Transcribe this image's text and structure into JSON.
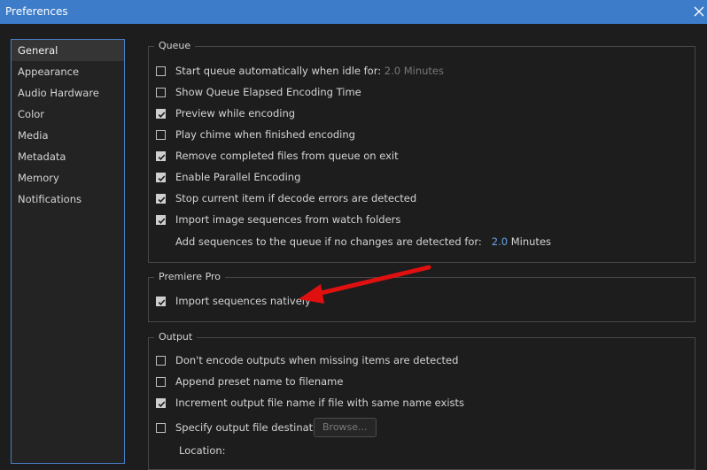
{
  "window": {
    "title": "Preferences",
    "close_label": "✕"
  },
  "sidebar": {
    "items": [
      {
        "label": "General",
        "selected": true
      },
      {
        "label": "Appearance"
      },
      {
        "label": "Audio Hardware"
      },
      {
        "label": "Color"
      },
      {
        "label": "Media"
      },
      {
        "label": "Metadata"
      },
      {
        "label": "Memory"
      },
      {
        "label": "Notifications"
      }
    ]
  },
  "queue": {
    "legend": "Queue",
    "start_auto": {
      "label": "Start queue automatically when idle for:",
      "value": "2.0",
      "unit": "Minutes",
      "checked": false
    },
    "show_elapsed": {
      "label": "Show Queue Elapsed Encoding Time",
      "checked": false
    },
    "preview": {
      "label": "Preview while encoding",
      "checked": true
    },
    "chime": {
      "label": "Play chime when finished encoding",
      "checked": false
    },
    "remove_completed": {
      "label": "Remove completed files from queue on exit",
      "checked": true
    },
    "parallel": {
      "label": "Enable Parallel Encoding",
      "checked": true
    },
    "stop_on_errors": {
      "label": "Stop current item if decode errors are detected",
      "checked": true
    },
    "import_image_seq": {
      "label": "Import image sequences from watch folders",
      "checked": true
    },
    "add_sequences": {
      "label": "Add sequences to the queue if no changes are detected for:",
      "value": "2.0",
      "unit": "Minutes"
    }
  },
  "premiere": {
    "legend": "Premiere Pro",
    "import_natively": {
      "label": "Import sequences natively",
      "checked": true
    }
  },
  "output": {
    "legend": "Output",
    "dont_encode": {
      "label": "Don't encode outputs when missing items are detected",
      "checked": false
    },
    "append_preset": {
      "label": "Append preset name to filename",
      "checked": false
    },
    "increment": {
      "label": "Increment output file name if file with same name exists",
      "checked": true
    },
    "specify_dest": {
      "label": "Specify output file destination:",
      "checked": false
    },
    "browse_label": "Browse...",
    "location_label": "Location:"
  },
  "colors": {
    "accent": "#3d7cc9",
    "annotation_arrow": "#e01010",
    "value_link": "#6aa3e6"
  }
}
